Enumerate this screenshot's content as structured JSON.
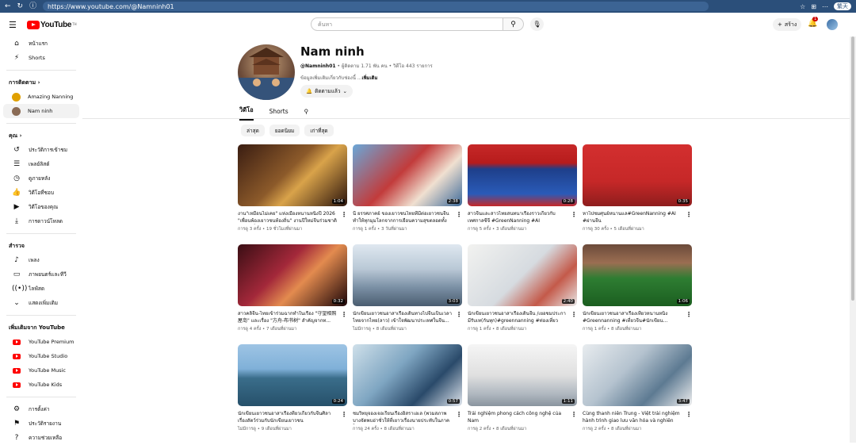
{
  "browser": {
    "url": "https://www.youtube.com/@Namninh01",
    "profile": "繁天"
  },
  "header": {
    "logo_text": "YouTube",
    "logo_reg": "TH",
    "search_placeholder": "ค้นหา",
    "create_label": "สร้าง",
    "notif_count": "1"
  },
  "sidebar": {
    "main": [
      {
        "label": "หน้าแรก",
        "icon": "home-icon",
        "glyph": "⌂"
      },
      {
        "label": "Shorts",
        "icon": "shorts-icon",
        "glyph": "⚡"
      }
    ],
    "subs_head": "การติดตาม",
    "subs": [
      {
        "label": "Amazing Nanning",
        "color": "#e0a000"
      },
      {
        "label": "Nam ninh",
        "color": "#8a6b55"
      }
    ],
    "you_head": "คุณ",
    "you": [
      {
        "label": "ประวัติการเข้าชม",
        "icon": "history-icon",
        "glyph": "↺"
      },
      {
        "label": "เพลย์ลิสต์",
        "icon": "playlist-icon",
        "glyph": "☰"
      },
      {
        "label": "ดูภายหลัง",
        "icon": "watch-later-icon",
        "glyph": "◷"
      },
      {
        "label": "วิดีโอที่ชอบ",
        "icon": "like-icon",
        "glyph": "👍"
      },
      {
        "label": "วิดีโอของคุณ",
        "icon": "your-videos-icon",
        "glyph": "▶"
      },
      {
        "label": "การดาวน์โหลด",
        "icon": "download-icon",
        "glyph": "⤓"
      }
    ],
    "explore_head": "สำรวจ",
    "explore": [
      {
        "label": "เพลง",
        "icon": "music-icon",
        "glyph": "♪"
      },
      {
        "label": "ภาพยนตร์และทีวี",
        "icon": "movies-icon",
        "glyph": "▭"
      },
      {
        "label": "ไลฟ์สด",
        "icon": "live-icon",
        "glyph": "((•))"
      },
      {
        "label": "แสดงเพิ่มเติม",
        "icon": "chevron-down-icon",
        "glyph": "⌄"
      }
    ],
    "more_head": "เพิ่มเติมจาก YouTube",
    "more": [
      {
        "label": "YouTube Premium"
      },
      {
        "label": "YouTube Studio"
      },
      {
        "label": "YouTube Music"
      },
      {
        "label": "YouTube Kids"
      }
    ],
    "bottom": [
      {
        "label": "การตั้งค่า",
        "icon": "settings-icon",
        "glyph": "⚙"
      },
      {
        "label": "ประวัติรายงาน",
        "icon": "flag-icon",
        "glyph": "⚑"
      },
      {
        "label": "ความช่วยเหลือ",
        "icon": "help-icon",
        "glyph": "?"
      }
    ]
  },
  "channel": {
    "name": "Nam ninh",
    "handle": "@Namninh01",
    "subscribers": " • ผู้ติดตาม 1.71 พัน คน • วิดีโอ 443 รายการ",
    "desc": "ข้อมูลเพิ่มเติมเกี่ยวกับช่องนี้ ...",
    "desc_more": "เพิ่มเติม",
    "sub_label": "ติดตามแล้ว"
  },
  "tabs": [
    "วิดีโอ",
    "Shorts"
  ],
  "chips": [
    "ล่าสุด",
    "ยอดนิยม",
    "เก่าที่สุด"
  ],
  "videos": [
    {
      "title": "งาน\"เหมือนไม่เคย\" แห่งเมืองหนานหนิงปี 2026 \"เพื่อนพ้องเยาวชนท้องถิ่น\" งานปีใหม่จีนร่วมชาติประเทศไทย...",
      "meta": "การดู 3 ครั้ง • 19 ชั่วโมงที่ผ่านมา",
      "dur": "1:04",
      "bg": "linear-gradient(135deg,#3a1d12,#8c5a2a 45%,#d9a34a 60%,#2b140c)"
    },
    {
      "title": "นี้ ยรรศภาคย์ ของเยาวชนไทยที่มีต่อเยาวชนจีนทำให้ทุกมุมโลกจากการเยือนความสุขตลอดทั้งปี#fypppp...",
      "meta": "การดู 1 ครั้ง • 3 วันที่ผ่านมา",
      "dur": "2:38",
      "bg": "linear-gradient(135deg,#6aa7d8,#c23b3b 45%,#f0e0d0 70%,#3d6a9a)"
    },
    {
      "title": "สาวจีนและสาวไทยสนทนาเรื่องราวเกี่ยวกับเทศกาลซีจี #GreenNanning #AI #FriendsWo...",
      "meta": "การดู 5 ครั้ง • 3 เดือนที่ผ่านมา",
      "dur": "0:28",
      "bg": "linear-gradient(180deg,#c62828,#b71c1c 30%,#1e3f8a 40%,#2a5bb8 80%,#c62828)"
    },
    {
      "title": "หาไปชมศุนย์หนานแล#GreenNanning #AI #ผ่านจีน",
      "meta": "การดู 30 ครั้ง • 5 เดือนที่ผ่านมา",
      "dur": "0:35",
      "bg": "linear-gradient(180deg,#d32f2f,#c62828 60%,#8e1d1d)"
    },
    {
      "title": "สาวคลิจีน-ไทยเข้าร่วมฉากทำในเรื่อง \"守望相照屋岛\" และเรื่อง \"方舟-布书树\" สำคัญจากท...",
      "meta": "การดู 4 ครั้ง • 7 เดือนที่ผ่านมา",
      "dur": "0:32",
      "bg": "linear-gradient(135deg,#3a0e14,#a3283a 40%,#e38b4f 60%,#1c0508)"
    },
    {
      "title": "นักเขียนเยาวชนอาสาเรื่องเดินทางไปจีนเป็นเวลา ไทยจากไทย(ลาว) เข้าใจพัฒนาประเทศในจีน...",
      "meta": "ไม่มีการดู • 8 เดือนที่ผ่านมา",
      "dur": "3:03",
      "bg": "linear-gradient(180deg,#dfe8f0,#b9c8d6 40%,#7a8fa4 70%,#4a5d70)"
    },
    {
      "title": "นักเขียนเยาวชนอาสาเรื่องเดินจีน /เยอชมประกามีรับเท(กันทุก)#greennanning #ท่องเที่ยว #นักเขียน",
      "meta": "การดู 1 ครั้ง • 8 เดือนที่ผ่านมา",
      "dur": "2:40",
      "bg": "linear-gradient(135deg,#f2f2f0,#d6dbe0 50%,#c45a4a 75%,#e8e8e8)"
    },
    {
      "title": "นักเขียนเยาวชนอาสาเรื่องเที่ยวหนานหนิง #Greennanning #เที่ยวจีน#นักเขียน...",
      "meta": "การดู 1 ครั้ง • 8 เดือนที่ผ่านมา",
      "dur": "1:06",
      "bg": "linear-gradient(180deg,#6b4a3a,#9b6e52 30%,#2e7d32 55%,#1b5e20)"
    },
    {
      "title": "นักเขียนเยาวชนอาสาเรื่องที่ยวเกี่ยวกับจีนศิลาเรื่องสัตว์ร่วมกับนักเขียนเยาวชน",
      "meta": "ไม่มีการดู • 9 เดือนที่ผ่านมา",
      "dur": "0:24",
      "bg": "linear-gradient(180deg,#9ec4e4,#7fb0d8 40%,#3a6d8a 55%,#26506a)"
    },
    {
      "title": "ชมวิทยุจองเจอเรียนเรื่องอิสราเอเล (พวมสภาพบางจัดพบอ่าชั่วให้ที่เยาวเรื่องนายประทับในภาคใต้...",
      "meta": "การดู 24 ครั้ง • 8 เดือนที่ผ่านมา",
      "dur": "0:57",
      "bg": "linear-gradient(135deg,#cfe0ea,#7fa6c2 40%,#2a4a6a 70%,#e0e6ee)"
    },
    {
      "title": "Trải nghiệm phong cách công nghệ của Nam Ninh!#Tayrongtayhuongtoituonglai#Green...",
      "meta": "การดู 2 ครั้ง • 8 เดือนที่ผ่านมา",
      "dur": "1:11",
      "bg": "linear-gradient(180deg,#f5f5f5,#e0e0e0 50%,#b0b8c0 80%,#8a949e)"
    },
    {
      "title": "Cùng thanh niên Trung - Việt trải nghiệm hành trình giao lưu văn hóa và nghiên cứu...",
      "meta": "การดู 2 ครั้ง • 8 เดือนที่ผ่านมา",
      "dur": "3:47",
      "bg": "linear-gradient(135deg,#e8ecef,#b5c3cf 40%,#5d7a92 70%,#f0f0f0)"
    }
  ]
}
